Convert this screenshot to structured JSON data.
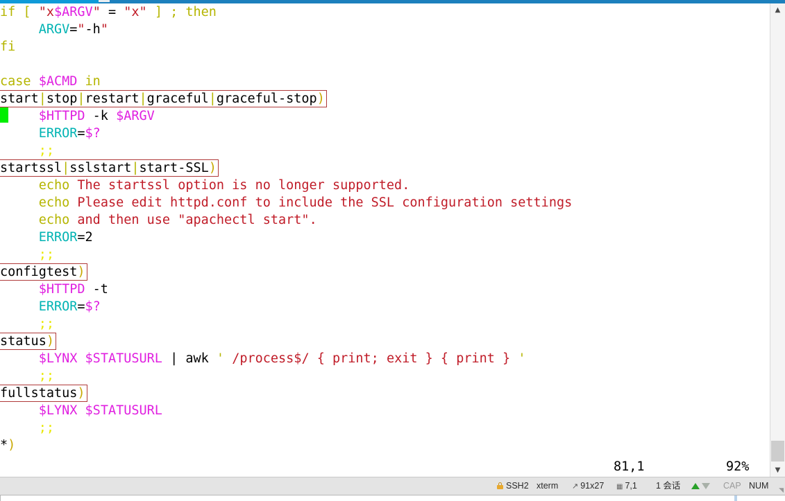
{
  "window": {
    "accent_color": "#1d80bd",
    "accent_active_color": "#0f9ad8"
  },
  "terminal": {
    "background": "#ffffff",
    "font_size_px": 18.5,
    "cursor_color": "#00ee00",
    "colors": {
      "keyword": "#b5b500",
      "string": "#c01c28",
      "variable": "#e020e0",
      "identifier": "#00b3b3",
      "plain": "#000000",
      "terminator": "#e8e800",
      "case_label_border": "#b03a3a"
    },
    "lines": [
      {
        "id": "l1",
        "text": "if [ \"x$ARGV\" = \"x\" ] ; then"
      },
      {
        "id": "l2",
        "text": "    ARGV=\"-h\""
      },
      {
        "id": "l3",
        "text": "fi"
      },
      {
        "id": "l4",
        "text": ""
      },
      {
        "id": "l5",
        "text": "case $ACMD in"
      },
      {
        "id": "l6",
        "text": "start|stop|restart|graceful|graceful-stop)"
      },
      {
        "id": "l7",
        "text": "    $HTTPD -k $ARGV"
      },
      {
        "id": "l8",
        "text": "    ERROR=$?"
      },
      {
        "id": "l9",
        "text": "    ;;"
      },
      {
        "id": "l10",
        "text": "startssl|sslstart|start-SSL)"
      },
      {
        "id": "l11",
        "text": "    echo The startssl option is no longer supported."
      },
      {
        "id": "l12",
        "text": "    echo Please edit httpd.conf to include the SSL configuration settings"
      },
      {
        "id": "l13",
        "text": "    echo and then use \"apachectl start\"."
      },
      {
        "id": "l14",
        "text": "    ERROR=2"
      },
      {
        "id": "l15",
        "text": "    ;;"
      },
      {
        "id": "l16",
        "text": "configtest)"
      },
      {
        "id": "l17",
        "text": "    $HTTPD -t"
      },
      {
        "id": "l18",
        "text": "    ERROR=$?"
      },
      {
        "id": "l19",
        "text": "    ;;"
      },
      {
        "id": "l20",
        "text": "status)"
      },
      {
        "id": "l21",
        "text": "    $LYNX $STATUSURL | awk ' /process$/ { print; exit } { print } '"
      },
      {
        "id": "l22",
        "text": "    ;;"
      },
      {
        "id": "l23",
        "text": "fullstatus)"
      },
      {
        "id": "l24",
        "text": "    $LYNX $STATUSURL"
      },
      {
        "id": "l25",
        "text": "    ;;"
      },
      {
        "id": "l26",
        "text": "*)"
      }
    ],
    "tokens": {
      "if": "if",
      "bracket_open": "[",
      "q": "\"",
      "x": "x",
      "argv_var": "$ARGV",
      "eq": "=",
      "bracket_close": "]",
      "semicolon": ";",
      "then": "then",
      "argv_ident": "ARGV",
      "assign": "=",
      "dash_h": "-h",
      "fi": "fi",
      "case": "case",
      "acmd_var": "$ACMD",
      "in": "in",
      "label_start": "start",
      "label_stop": "stop",
      "label_restart": "restart",
      "label_graceful": "graceful",
      "label_graceful_stop": "graceful-stop",
      "pipe": "|",
      "rparen": ")",
      "httpd_var": "$HTTPD",
      "flag_k": "-k",
      "error_ident": "ERROR",
      "status_var": "$?",
      "terminator": ";;",
      "label_startssl": "startssl",
      "label_sslstart": "sslstart",
      "label_start_ssl": "start-SSL",
      "echo": "echo",
      "msg1": "The startssl option is no longer supported.",
      "msg2": "Please edit httpd.conf to include the SSL configuration settings",
      "msg3_a": "and then use ",
      "msg3_b": "apachectl start",
      "msg3_c": ".",
      "error_value": "2",
      "label_configtest": "configtest",
      "flag_t": "-t",
      "label_status": "status",
      "lynx_var": "$LYNX",
      "statusurl_var": "$STATUSURL",
      "awk": "awk",
      "quote": "'",
      "awk_body": " /process$/ { print; exit } { print } ",
      "label_fullstatus": "fullstatus",
      "star": "*"
    }
  },
  "ruler": {
    "position": "81,1",
    "percent": "92%"
  },
  "scrollbar": {
    "up_arrow": "scroll-up",
    "down_arrow": "scroll-down"
  },
  "statusbar": {
    "protocol": "SSH2",
    "terminal_type": "xterm",
    "dimensions": "91x27",
    "cursor_position": "7,1",
    "sessions": "1 会话",
    "caps_lock": "CAP",
    "num_lock": "NUM",
    "lock_icon": "padlock-icon",
    "resize_grip": "resize-grip"
  }
}
